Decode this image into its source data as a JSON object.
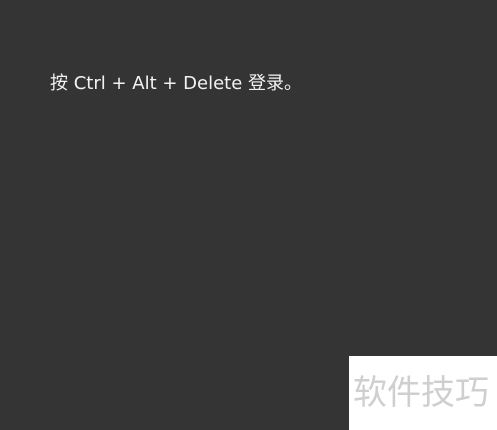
{
  "login_screen": {
    "prompt": "按 Ctrl + Alt + Delete 登录。"
  },
  "watermark": {
    "text": "软件技巧"
  },
  "colors": {
    "background": "#343434",
    "prompt_text": "#f2f2f2",
    "watermark_bg": "#ffffff",
    "watermark_text": "#cfcfcf"
  }
}
